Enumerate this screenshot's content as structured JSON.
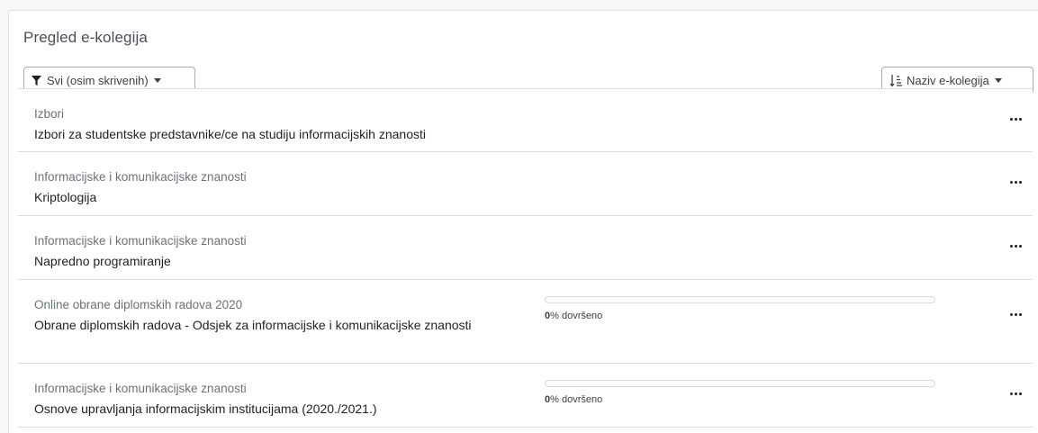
{
  "block": {
    "title": "Pregled e-kolegija",
    "filter_label": "Svi (osim skrivenih)",
    "sort_label": "Naziv e-kolegija"
  },
  "courses": [
    {
      "category": "Izbori",
      "name": "Izbori za studentske predstavnike/ce na studiju informacijskih znanosti",
      "show_progress": false
    },
    {
      "category": "Informacijske i komunikacijske znanosti",
      "name": "Kriptologija",
      "show_progress": false
    },
    {
      "category": "Informacijske i komunikacijske znanosti",
      "name": "Napredno programiranje",
      "show_progress": false
    },
    {
      "category": "Online obrane diplomskih radova 2020",
      "name": "Obrane diplomskih radova - Odsjek za informacijske i komunikacijske znanosti",
      "show_progress": true,
      "progress_value": 0,
      "progress_number": "0",
      "progress_suffix": "% dovršeno"
    },
    {
      "category": "Informacijske i komunikacijske znanosti",
      "name": "Osnove upravljanja informacijskim institucijama (2020./2021.)",
      "show_progress": true,
      "progress_value": 0,
      "progress_number": "0",
      "progress_suffix": "% dovršeno"
    }
  ],
  "colors": {
    "accent": "#0f6cbf",
    "muted_text": "#6a737b"
  },
  "icons": {
    "filter": "filter-icon",
    "sort": "sort-alpha-icon",
    "menu": "ellipsis-icon"
  }
}
